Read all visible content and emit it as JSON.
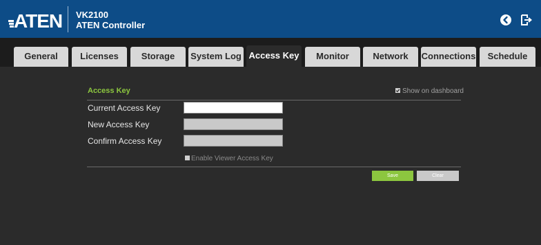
{
  "header": {
    "logo_text": "ATEN",
    "model": "VK2100",
    "product": "ATEN Controller"
  },
  "tabs": [
    {
      "label": "General"
    },
    {
      "label": "Licenses"
    },
    {
      "label": "Storage"
    },
    {
      "label": "System Log"
    },
    {
      "label": "Access Key",
      "active": true
    },
    {
      "label": "Monitor"
    },
    {
      "label": "Network"
    },
    {
      "label": "Connections"
    },
    {
      "label": "Schedule"
    }
  ],
  "access_key": {
    "title": "Access Key",
    "show_on_dashboard_label": "Show on dashboard",
    "show_on_dashboard_checked": true,
    "current_label": "Current Access Key",
    "current_value": "",
    "new_label": "New Access Key",
    "new_value": "",
    "confirm_label": "Confirm Access Key",
    "confirm_value": "",
    "enable_viewer_label": "Enable Viewer Access Key",
    "enable_viewer_checked": false,
    "save_label": "Save",
    "clear_label": "Clear"
  },
  "colors": {
    "header_bg": "#0d4c87",
    "tab_bg": "#d8d8d8",
    "panel_bg": "#2b2b2b",
    "accent_green": "#8cc63f"
  },
  "icons": {
    "back": "back-circle-icon",
    "logout": "logout-icon",
    "checkbox_checked": "checkbox-checked-icon",
    "checkbox_unchecked": "checkbox-unchecked-icon"
  }
}
